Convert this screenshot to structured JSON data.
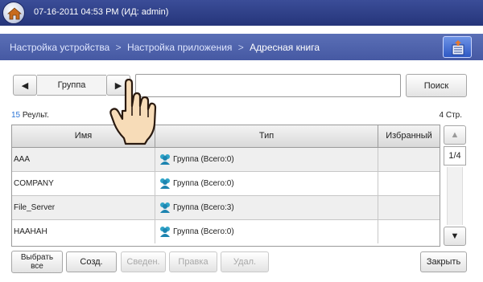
{
  "header": {
    "datetime": "07-16-2011 04:53 PM (ИД: admin)",
    "home_icon": "home-icon"
  },
  "breadcrumb": {
    "items": [
      "Настройка устройства",
      "Настройка приложения",
      "Адресная книга"
    ],
    "separator": ">",
    "action_icon": "address-book-icon"
  },
  "toolbar": {
    "prev_icon": "◀",
    "next_icon": "▶",
    "group_label": "Группа",
    "search_value": "",
    "search_label": "Поиск"
  },
  "results": {
    "count": "15",
    "label": "Реульт.",
    "pages": "4 Стр."
  },
  "table": {
    "columns": [
      "Имя",
      "Тип",
      "Избранный"
    ],
    "rows": [
      {
        "name": "AAA",
        "type": "Группа (Всего:0)",
        "favorite": ""
      },
      {
        "name": "COMPANY",
        "type": "Группа (Всего:0)",
        "favorite": ""
      },
      {
        "name": "File_Server",
        "type": "Группа (Всего:3)",
        "favorite": ""
      },
      {
        "name": "HAAHAH",
        "type": "Группа (Всего:0)",
        "favorite": ""
      }
    ]
  },
  "scroll": {
    "page_indicator": "1/4",
    "up_icon": "▲",
    "down_icon": "▼"
  },
  "actions": {
    "select_all_line1": "Выбрать",
    "select_all_line2": "все",
    "create": "Созд.",
    "merge": "Сведен.",
    "edit": "Правка",
    "delete": "Удал.",
    "close": "Закрыть"
  },
  "colors": {
    "header_bg": "#2d3d86",
    "breadcrumb_bg": "#4f62ab",
    "accent_count": "#2b74d6"
  }
}
